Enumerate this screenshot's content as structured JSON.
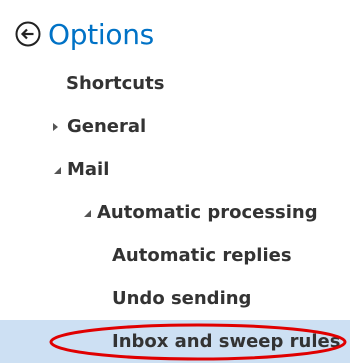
{
  "header": {
    "back_icon": "back-arrow-circle-icon",
    "title": "Options"
  },
  "nav": {
    "items": [
      {
        "label": "Shortcuts",
        "expander": "none"
      },
      {
        "label": "General",
        "expander": "collapsed"
      },
      {
        "label": "Mail",
        "expander": "expanded"
      },
      {
        "label": "Automatic processing",
        "expander": "expanded"
      },
      {
        "label": "Automatic replies",
        "expander": "none"
      },
      {
        "label": "Undo sending",
        "expander": "none"
      },
      {
        "label": "Inbox and sweep rules",
        "expander": "none",
        "selected": true
      }
    ]
  },
  "colors": {
    "title": "#0072c6",
    "selected_background": "#cde0f3",
    "annotation_circle": "#e00000"
  }
}
